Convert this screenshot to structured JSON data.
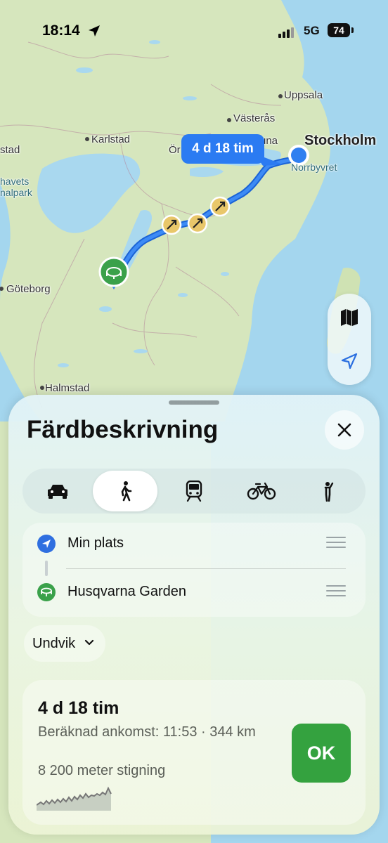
{
  "status_bar": {
    "time": "18:14",
    "network": "5G",
    "battery": "74"
  },
  "map": {
    "labels": {
      "uppsala": "Uppsala",
      "vasteras": "Västerås",
      "stockholm": "Stockholm",
      "norrbyvret": "Norrbyvret",
      "karlstad": "Karlstad",
      "stad": "stad",
      "orebro": "Ör",
      "una": "una",
      "havets1": "havets",
      "havets2": "nalpark",
      "goteborg": "Göteborg",
      "halmstad": "Halmstad"
    },
    "eta_bubble": "4 d 18 tim",
    "controls": {
      "map_mode_icon": "map-icon",
      "locate_icon": "location-arrow-icon"
    }
  },
  "sheet": {
    "title": "Färdbeskrivning",
    "close_icon": "close-icon",
    "modes": [
      {
        "name": "car",
        "icon": "car-icon",
        "active": false
      },
      {
        "name": "walk",
        "icon": "walking-icon",
        "active": true
      },
      {
        "name": "transit",
        "icon": "train-icon",
        "active": false
      },
      {
        "name": "bike",
        "icon": "bicycle-icon",
        "active": false
      },
      {
        "name": "hail",
        "icon": "person-hailing-icon",
        "active": false
      }
    ],
    "stops": [
      {
        "label": "Min plats",
        "icon": "location-arrow-icon"
      },
      {
        "label": "Husqvarna Garden",
        "icon": "stadium-icon"
      }
    ],
    "avoid_label": "Undvik",
    "route": {
      "duration": "4 d 18 tim",
      "eta": "Beräknad ankomst: 11:53 · 344 km",
      "climb": "8 200 meter stigning",
      "ok_label": "OK"
    }
  },
  "colors": {
    "route_blue": "#2b7bf2",
    "ok_green": "#34a23f",
    "water": "#9fd3ec",
    "land": "#d3e4b9"
  }
}
